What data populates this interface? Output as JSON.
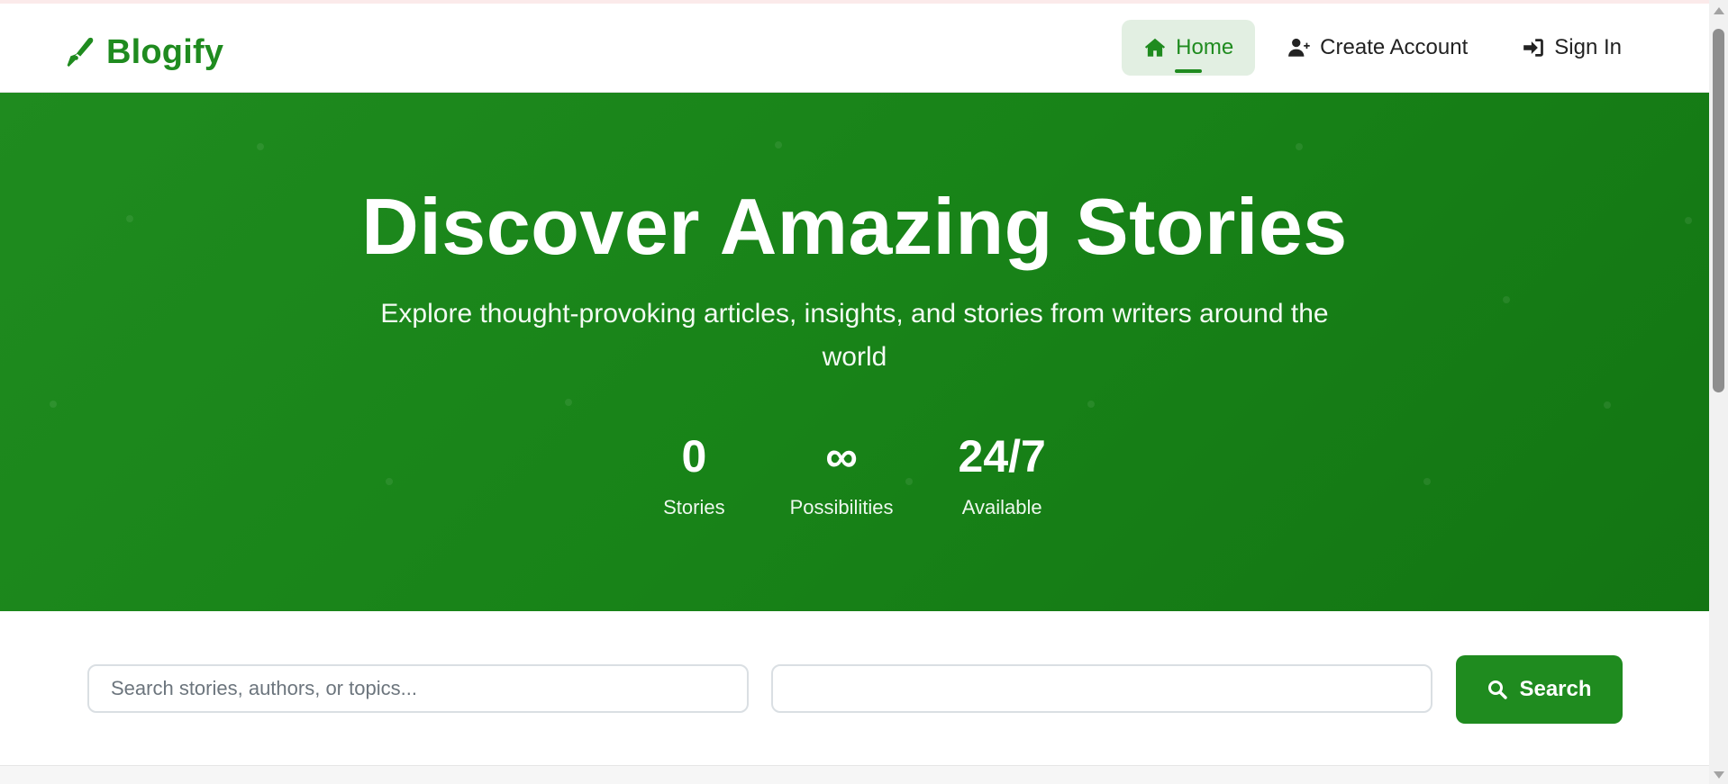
{
  "brand": {
    "name": "Blogify",
    "icon": "pen-nib-icon"
  },
  "nav": {
    "items": [
      {
        "label": "Home",
        "icon": "home-icon",
        "active": true
      },
      {
        "label": "Create Account",
        "icon": "user-plus-icon",
        "active": false
      },
      {
        "label": "Sign In",
        "icon": "sign-in-icon",
        "active": false
      }
    ]
  },
  "hero": {
    "title": "Discover Amazing Stories",
    "subtitle": "Explore thought-provoking articles, insights, and stories from writers around the world",
    "stats": [
      {
        "value": "0",
        "label": "Stories"
      },
      {
        "value": "∞",
        "label": "Possibilities"
      },
      {
        "value": "24/7",
        "label": "Available"
      }
    ]
  },
  "search": {
    "query_placeholder": "Search stories, authors, or topics...",
    "query_value": "",
    "secondary_value": "",
    "button_label": "Search",
    "button_icon": "search-icon"
  },
  "colors": {
    "brand_green": "#1f8b1f",
    "active_nav_bg": "#e2efe2",
    "text_dark": "#222222"
  }
}
